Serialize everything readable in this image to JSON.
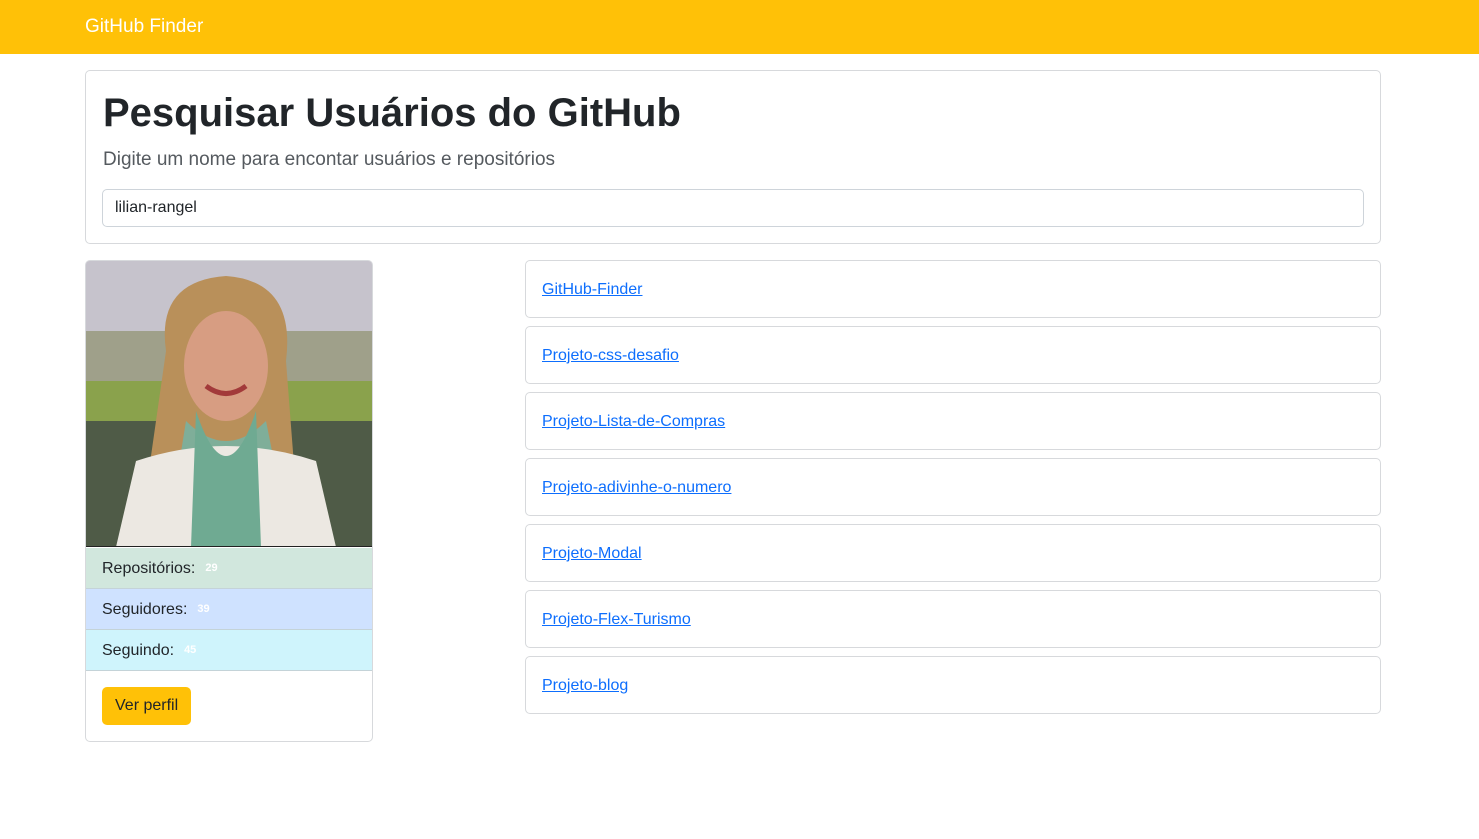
{
  "navbar": {
    "brand": "GitHub Finder"
  },
  "search": {
    "title": "Pesquisar Usuários do GitHub",
    "subtitle": "Digite um nome para encontar usuários e repositórios",
    "value": "lilian-rangel"
  },
  "profile": {
    "stats": {
      "repos_label": "Repositórios:",
      "repos_count": "29",
      "followers_label": "Seguidores:",
      "followers_count": "39",
      "following_label": "Seguindo:",
      "following_count": "45"
    },
    "view_button": "Ver perfil"
  },
  "repos": [
    "GitHub-Finder",
    "Projeto-css-desafio",
    "Projeto-Lista-de-Compras",
    "Projeto-adivinhe-o-numero",
    "Projeto-Modal",
    "Projeto-Flex-Turismo",
    "Projeto-blog"
  ],
  "colors": {
    "accent": "#ffc107",
    "link": "#0d6efd",
    "repos_bg": "#d1e7dd",
    "followers_bg": "#cfe2ff",
    "following_bg": "#cff4fc"
  }
}
